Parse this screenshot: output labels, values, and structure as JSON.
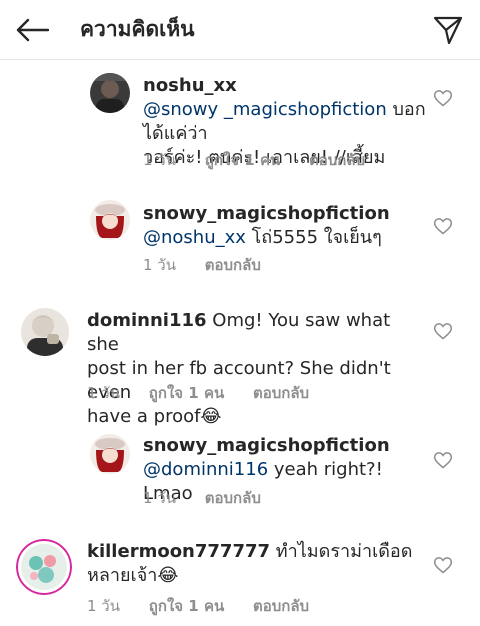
{
  "header": {
    "title": "ความคิดเห็น"
  },
  "comments": [
    {
      "username": "noshu_xx",
      "mention": "@snowy _magicshopfiction",
      "text_line1_after": " บอกได้แค่ว่า",
      "text_line2": "วอร์ค่ะ! ตบค่ะ! เอาเลย! //เสี้ยม",
      "time": "1 วัน",
      "likes": "ถูกใจ 1 คน",
      "reply": "ตอบกลับ"
    },
    {
      "username": "snowy_magicshopfiction",
      "mention": "@noshu_xx",
      "text": " โถ่5555 ใจเย็นๆ",
      "time": "1 วัน",
      "reply": "ตอบกลับ"
    },
    {
      "username": "dominni116",
      "line1": " Omg! You saw what she",
      "line2": "post in her fb account? She didn't even",
      "line3": "have a proof😂",
      "time": "1 วัน",
      "likes": "ถูกใจ 1 คน",
      "reply": "ตอบกลับ"
    },
    {
      "username": "snowy_magicshopfiction",
      "mention": "@dominni116",
      "text": " yeah right?! Lmao",
      "time": "1 วัน",
      "reply": "ตอบกลับ"
    },
    {
      "username": "killermoon777777",
      "line1": " ทำไมดราม่าเดือด",
      "line2": "หลายเจ้า😂",
      "time": "1 วัน",
      "likes": "ถูกใจ 1 คน",
      "reply": "ตอบกลับ"
    }
  ],
  "icons": {
    "back": "arrow-left-icon",
    "send": "paper-plane-icon",
    "like": "heart-outline-icon"
  },
  "colors": {
    "text": "#262626",
    "muted": "#8e8e8e",
    "mention": "#003569",
    "divider": "#e6e6e6"
  }
}
